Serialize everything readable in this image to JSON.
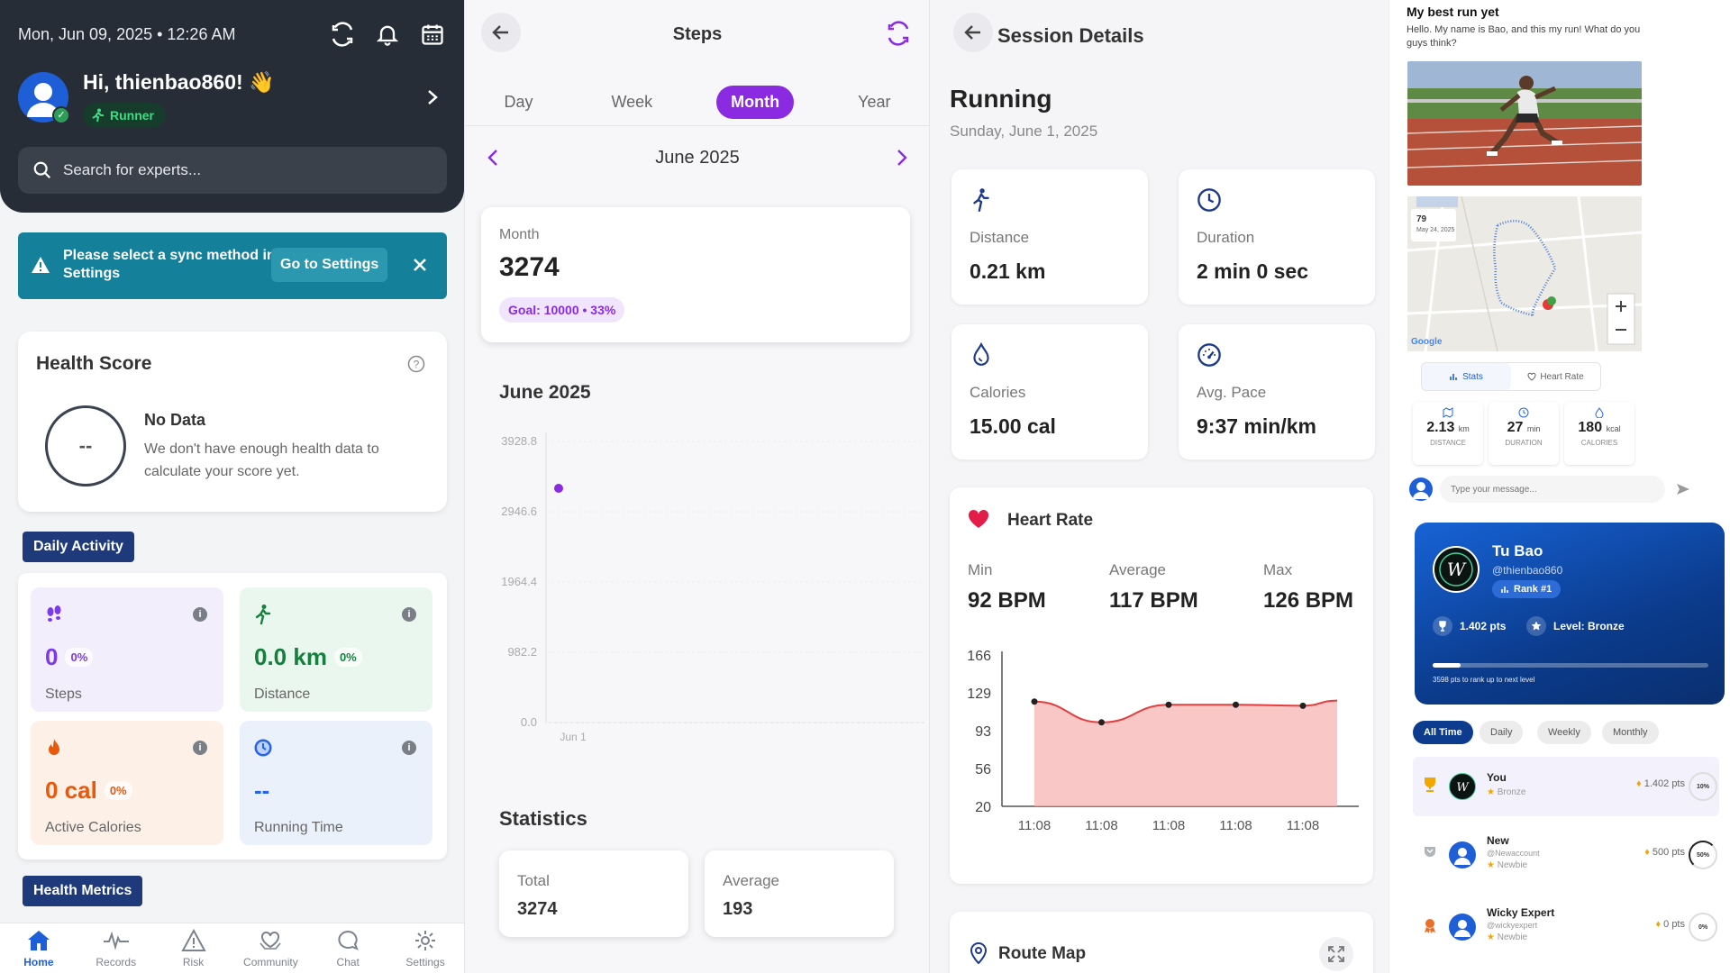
{
  "home": {
    "datetime": "Mon, Jun 09, 2025 • 12:26 AM",
    "greeting": "Hi, thienbao860! 👋",
    "role_badge": "Runner",
    "search_placeholder": "Search for experts...",
    "sync_banner": {
      "message": "Please select a sync method in Settings",
      "action": "Go to Settings"
    },
    "health_score": {
      "title": "Health Score",
      "score": "--",
      "status": "No Data",
      "description": "We don't have enough health data to calculate your score yet."
    },
    "daily_activity": {
      "title": "Daily Activity",
      "tiles": [
        {
          "value": "0",
          "pct": "0%",
          "label": "Steps",
          "icon": "footprints-icon",
          "color": "#7c3aed",
          "bg": "#f3eefc"
        },
        {
          "value": "0.0 km",
          "pct": "0%",
          "label": "Distance",
          "icon": "walking-icon",
          "color": "#15803d",
          "bg": "#eaf7ef"
        },
        {
          "value": "0 cal",
          "pct": "0%",
          "label": "Active Calories",
          "icon": "flame-icon",
          "color": "#ea580c",
          "bg": "#fdf0e7"
        },
        {
          "value": "--",
          "label": "Running Time",
          "icon": "clock-icon",
          "color": "#2563eb",
          "bg": "#eaf1fb"
        }
      ]
    },
    "health_metrics_title": "Health Metrics",
    "nav": [
      {
        "label": "Home",
        "icon": "home-icon",
        "active": true
      },
      {
        "label": "Records",
        "icon": "pulse-icon"
      },
      {
        "label": "Risk",
        "icon": "warning-icon"
      },
      {
        "label": "Community",
        "icon": "heart-hands-icon"
      },
      {
        "label": "Chat",
        "icon": "chat-icon"
      },
      {
        "label": "Settings",
        "icon": "gear-icon"
      }
    ]
  },
  "steps": {
    "title": "Steps",
    "tabs": [
      "Day",
      "Week",
      "Month",
      "Year"
    ],
    "active_tab": "Month",
    "period": "June 2025",
    "summary": {
      "label": "Month",
      "value": "3274",
      "goal": "Goal: 10000 • 33%"
    },
    "chart_title": "June 2025",
    "statistics_title": "Statistics",
    "stats": [
      {
        "label": "Total",
        "value": "3274"
      },
      {
        "label": "Average",
        "value": "193"
      }
    ]
  },
  "session": {
    "title": "Session Details",
    "activity": "Running",
    "date": "Sunday, June 1, 2025",
    "metrics": [
      {
        "label": "Distance",
        "value": "0.21 km",
        "icon": "walking-icon"
      },
      {
        "label": "Duration",
        "value": "2 min 0 sec",
        "icon": "clock-icon"
      },
      {
        "label": "Calories",
        "value": "15.00 cal",
        "icon": "drop-icon"
      },
      {
        "label": "Avg. Pace",
        "value": "9:37 min/km",
        "icon": "speedometer-icon"
      }
    ],
    "heart_rate": {
      "title": "Heart Rate",
      "min_label": "Min",
      "min": "92 BPM",
      "avg_label": "Average",
      "avg": "117 BPM",
      "max_label": "Max",
      "max": "126 BPM"
    },
    "route_map_title": "Route Map"
  },
  "post": {
    "title": "My best run yet",
    "body": "Hello. My name is Bao, and this my run! What do you guys think?",
    "map_badge_num": "79",
    "map_badge_date": "May 24, 2025",
    "map_brand": "Google",
    "tabs": [
      "Stats",
      "Heart Rate"
    ],
    "mini_stats": [
      {
        "value": "2.13",
        "unit": "km",
        "label": "DISTANCE"
      },
      {
        "value": "27",
        "unit": "min",
        "label": "DURATION"
      },
      {
        "value": "180",
        "unit": "kcal",
        "label": "CALORIES"
      }
    ],
    "message_placeholder": "Type your message..."
  },
  "profile": {
    "name": "Tu Bao",
    "handle": "@thienbao860",
    "rank": "Rank #1",
    "points": "1.402 pts",
    "level": "Level: Bronze",
    "progress_fraction": 0.1,
    "progress_note": "3598 pts to rank up to next level",
    "filters": [
      "All Time",
      "Daily",
      "Weekly",
      "Monthly"
    ],
    "leaderboard": [
      {
        "name": "You",
        "handle": "",
        "tier": "Bronze",
        "pts": "1.402 pts",
        "pct": "10%",
        "pct_value": 10
      },
      {
        "name": "New",
        "handle": "@Newaccount",
        "tier": "Newbie",
        "pts": "500 pts",
        "pct": "50%",
        "pct_value": 50
      },
      {
        "name": "Wicky Expert",
        "handle": "@wickyexpert",
        "tier": "Newbie",
        "pts": "0 pts",
        "pct": "0%",
        "pct_value": 0
      }
    ]
  },
  "chart_data": [
    {
      "type": "scatter",
      "title": "June 2025",
      "categories": [
        "Jun 1"
      ],
      "series": [
        {
          "values": [
            3274
          ]
        }
      ],
      "yticks": [
        "3928.8",
        "2946.6",
        "1964.4",
        "982.2",
        "0.0"
      ],
      "ylim": [
        0,
        3928.8
      ],
      "color": "#8a2be2"
    },
    {
      "type": "area",
      "x": [
        "11:08",
        "11:08",
        "11:08",
        "11:08",
        "11:08"
      ],
      "y": [
        121,
        101,
        118,
        118,
        117,
        122
      ],
      "yticks": [
        "166",
        "129",
        "93",
        "56",
        "20"
      ],
      "ylim": [
        20,
        166
      ],
      "color": "#e53e3e"
    }
  ]
}
